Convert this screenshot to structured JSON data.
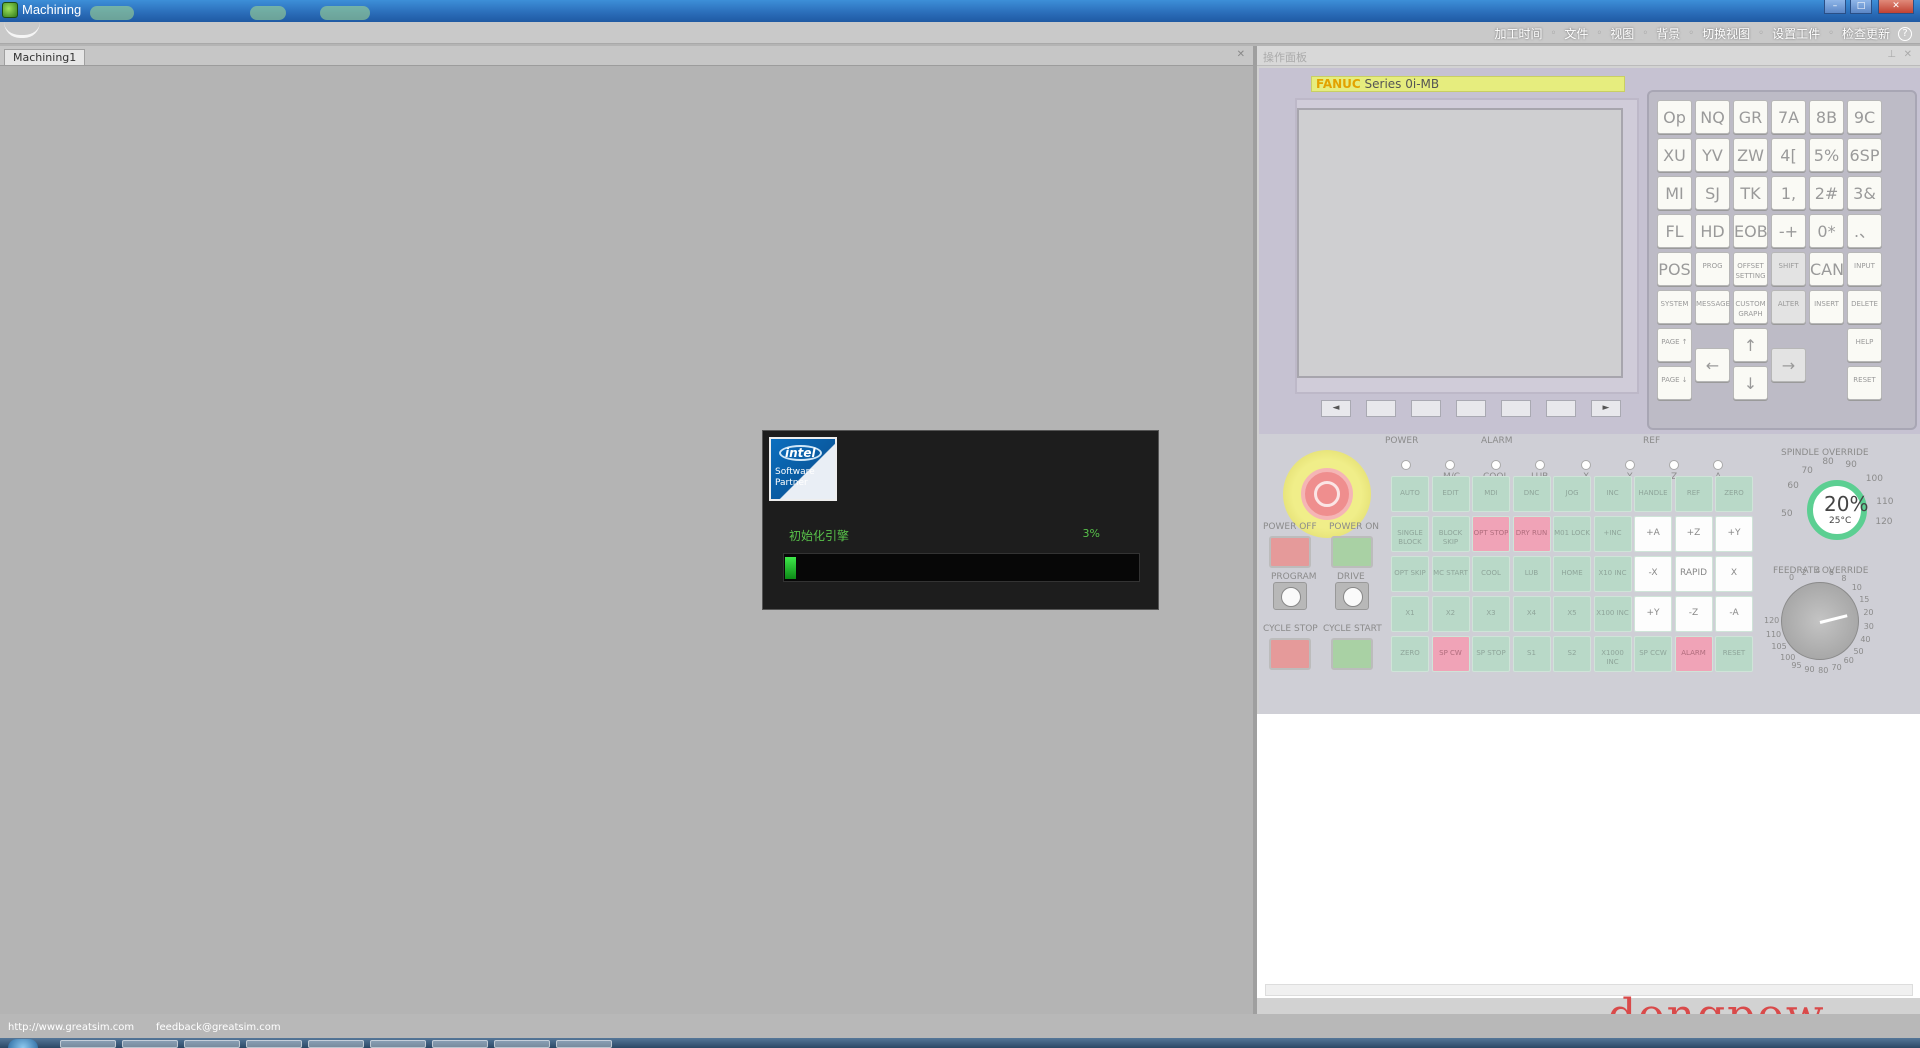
{
  "window": {
    "title": "Machining"
  },
  "menu": {
    "items": [
      "加工时间",
      "文件",
      "视图",
      "背景",
      "切换视图",
      "设置工件",
      "检查更新"
    ]
  },
  "document": {
    "tab": "Machining1"
  },
  "loading": {
    "badge_brand": "intel",
    "badge_line1": "Software",
    "badge_line2": "Partner",
    "status": "初始化引擎",
    "percent_text": "3%",
    "progress": 0.03
  },
  "right_panel": {
    "title": "操作面板",
    "fanuc_brand": "FANUC",
    "fanuc_series": "Series 0i-MB",
    "softkeys": [
      "◄",
      "",
      "",
      "",
      "",
      "",
      "►"
    ],
    "keypad": [
      [
        "Op",
        "NQ",
        "GR",
        "7A",
        "8B",
        "9C"
      ],
      [
        "XU",
        "YV",
        "ZW",
        "4[",
        "5%",
        "6SP"
      ],
      [
        "MI",
        "SJ",
        "TK",
        "1,",
        "2#",
        "3&"
      ],
      [
        "FL",
        "HD",
        "EOB",
        "-+",
        "0*",
        ".、"
      ],
      [
        "POS",
        "PROG",
        "OFFSET SETTING",
        "SHIFT",
        "CAN",
        "INPUT"
      ],
      [
        "SYSTEM",
        "MESSAGE",
        "CUSTOM GRAPH",
        "ALTER",
        "INSERT",
        "DELETE"
      ],
      [
        "PAGE ↑",
        "",
        "↑",
        "",
        "",
        "HELP"
      ],
      [
        "",
        "←",
        "",
        "→",
        "",
        ""
      ],
      [
        "PAGE ↓",
        "",
        "↓",
        "",
        "",
        "RESET"
      ]
    ],
    "labels": {
      "power": "POWER",
      "alarm": "ALARM",
      "ref": "REF",
      "alarm_leds": [
        "M/C",
        "COOL",
        "LUB"
      ],
      "ref_leds": [
        "X",
        "Y",
        "Z",
        "A"
      ],
      "power_off": "POWER OFF",
      "power_on": "POWER ON",
      "program": "PROGRAM",
      "drive": "DRIVE",
      "cycle_stop": "CYCLE STOP",
      "cycle_start": "CYCLE START",
      "spindle_override": "SPINDLE OVERRIDE",
      "feedrate_override": "FEEDRATE OVERRIDE"
    },
    "mode_keys": [
      [
        "AUTO",
        "EDIT",
        "MDI",
        "DNC",
        "JOG",
        "INC",
        "HANDLE",
        "REF",
        "ZERO"
      ],
      [
        "SINGLE BLOCK",
        "BLOCK SKIP",
        "OPT STOP",
        "DRY RUN",
        "M01 LOCK",
        "+INC",
        "+A",
        "+Z",
        "+Y"
      ],
      [
        "OPT SKIP",
        "MC START",
        "COOL",
        "LUB",
        "HOME",
        "X10 INC",
        "-X",
        "RAPID",
        "X"
      ],
      [
        "X1",
        "X2",
        "X3",
        "X4",
        "X5",
        "X100 INC",
        "+Y",
        "-Z",
        "-A"
      ],
      [
        "ZERO",
        "SP CW",
        "SP STOP",
        "S1",
        "S2",
        "X1000 INC",
        "SP CCW",
        "ALARM",
        "RESET"
      ]
    ],
    "spindle": {
      "value": "20%",
      "temp": "25°C",
      "ticks": [
        "60",
        "70",
        "80",
        "90",
        "100",
        "110",
        "120",
        "50"
      ]
    },
    "feed": {
      "ticks": [
        "0",
        "2",
        "4",
        "6",
        "8",
        "10",
        "15",
        "20",
        "30",
        "40",
        "50",
        "60",
        "70",
        "80",
        "90",
        "95",
        "100",
        "105",
        "110",
        "120"
      ]
    }
  },
  "watermark": "dongpow. com",
  "footer": {
    "url": "http://www.greatsim.com",
    "email": "feedback@greatsim.com"
  }
}
